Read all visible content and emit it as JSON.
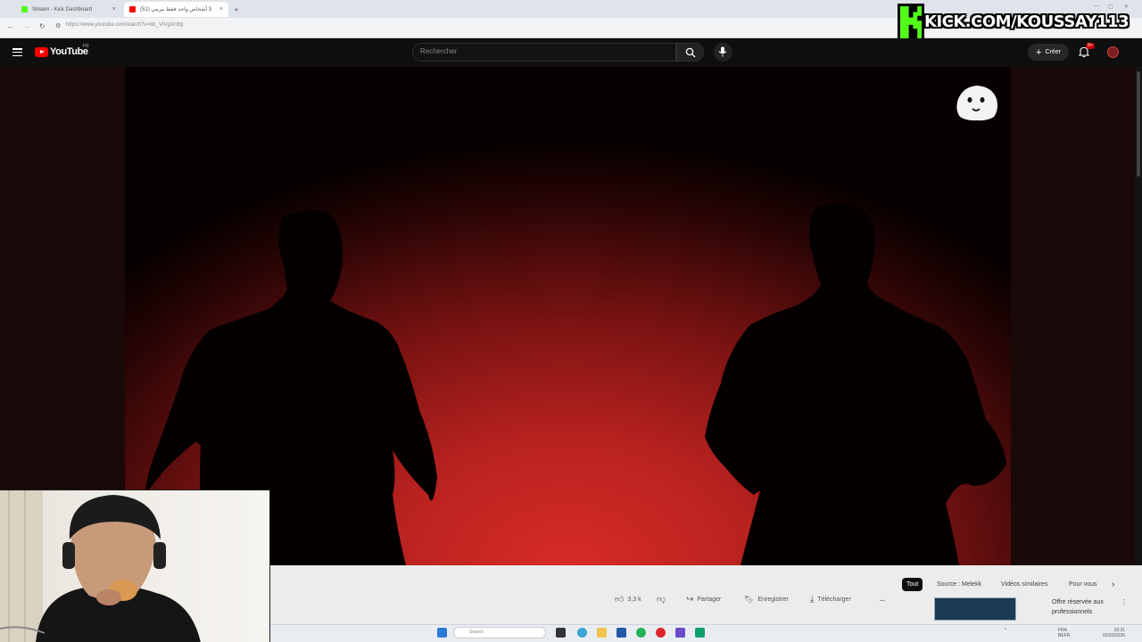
{
  "browser": {
    "tabs": [
      {
        "label": "Stream - Kick Dashboard",
        "icon": "kick-icon",
        "active": false
      },
      {
        "label": "3 أشخاص واحد فقط بيرمي (51)",
        "icon": "youtube-icon",
        "active": true
      }
    ],
    "url": "https://www.youtube.com/watch?v=bb_VIVgXrdtg",
    "new_tab": "+"
  },
  "overlay": {
    "kick_handle": "KICK.COM/KOUSSAY113",
    "brand_color": "#53fc18"
  },
  "youtube": {
    "logo_text": "YouTube",
    "country_code": "FR",
    "search_placeholder": "Rechercher",
    "create_label": "Créer",
    "notification_badge": "9+"
  },
  "video": {
    "description": "two black silhouettes on red background",
    "accent_color": "#d72b26"
  },
  "actions": {
    "likes": "3,3 k",
    "share": "Partager",
    "save": "Enregistrer",
    "download": "Télécharger",
    "more": "..."
  },
  "chips": [
    "Tout",
    "Source : Melekk",
    "Vidéos similaires",
    "Pour vous"
  ],
  "suggestion": {
    "title": "Offre réservée aux professionnels"
  },
  "taskbar": {
    "search_placeholder": "Search",
    "lang_line1": "FRA",
    "lang_line2": "BEFR",
    "time": "18:31",
    "date": "02/03/2026"
  }
}
